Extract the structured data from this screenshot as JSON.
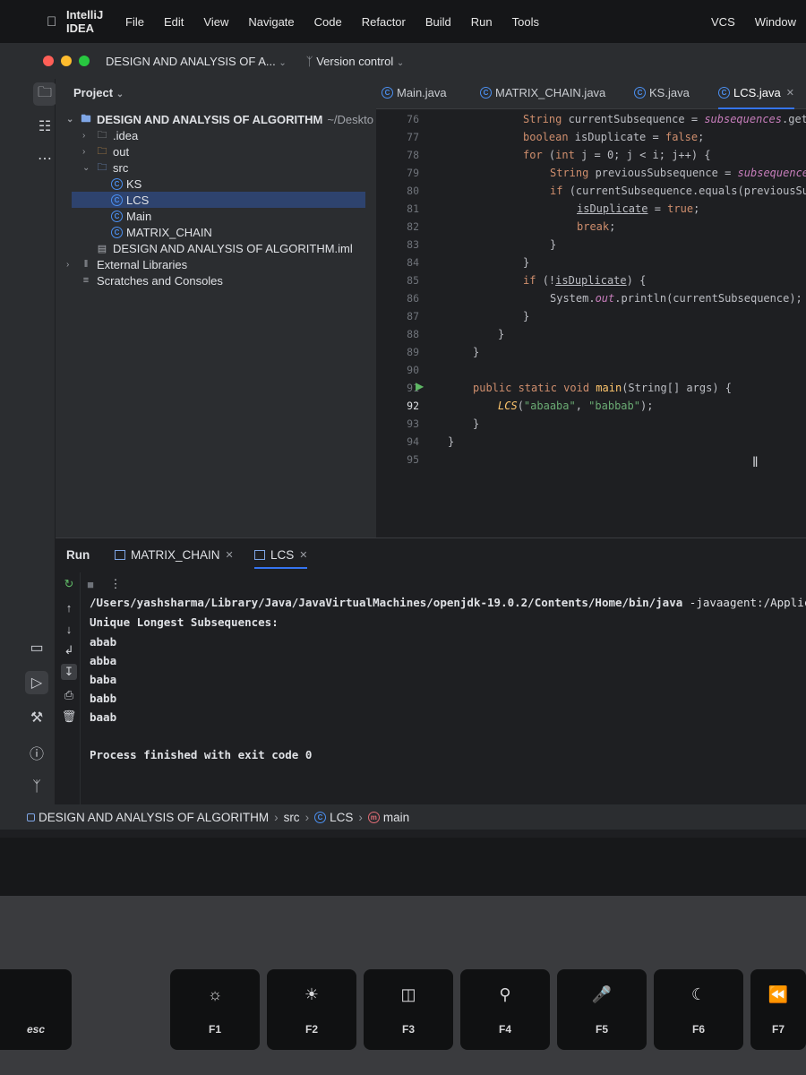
{
  "menubar": {
    "app": "IntelliJ IDEA",
    "items": [
      "File",
      "Edit",
      "View",
      "Navigate",
      "Code",
      "Refactor",
      "Build",
      "Run",
      "Tools",
      "VCS",
      "Window"
    ]
  },
  "titlebar": {
    "project": "DESIGN AND ANALYSIS OF A...",
    "version_control": "Version control"
  },
  "project_panel": {
    "title": "Project",
    "root": "DESIGN AND ANALYSIS OF ALGORITHM",
    "root_path": "~/Deskto",
    "idea": ".idea",
    "out": "out",
    "src": "src",
    "classes": [
      "KS",
      "LCS",
      "Main",
      "MATRIX_CHAIN"
    ],
    "iml": "DESIGN AND ANALYSIS OF ALGORITHM.iml",
    "external": "External Libraries",
    "scratches": "Scratches and Consoles"
  },
  "editor": {
    "tabs": [
      "Main.java",
      "MATRIX_CHAIN.java",
      "KS.java",
      "LCS.java"
    ],
    "line_numbers": [
      "76",
      "77",
      "78",
      "79",
      "80",
      "81",
      "82",
      "83",
      "84",
      "85",
      "86",
      "87",
      "88",
      "89",
      "90",
      "91",
      "92",
      "93",
      "94",
      "95"
    ],
    "code": {
      "l76a": "String ",
      "l76b": "currentSubsequence",
      "l76c": " = ",
      "l76d": "subsequences",
      "l76e": ".get(",
      "l77a": "boolean ",
      "l77b": "isDuplicate",
      "l77c": " = ",
      "l77d": "false",
      "l77e": ";",
      "l78a": "for ",
      "l78b": "(",
      "l78c": "int ",
      "l78d": "j = 0; j < i; j++) {",
      "l79a": "String ",
      "l79b": "previousSubsequence",
      "l79c": " = ",
      "l79d": "subsequence",
      "l80a": "if ",
      "l80b": "(currentSubsequence.equals(previousSu",
      "l81a": "isDuplicate",
      "l81b": " = ",
      "l81c": "true",
      "l81d": ";",
      "l82a": "break",
      "l82b": ";",
      "l83": "}",
      "l84": "}",
      "l85a": "if ",
      "l85b": "(!",
      "l85c": "isDuplicate",
      "l85d": ") {",
      "l86a": "System.",
      "l86b": "out",
      "l86c": ".println(currentSubsequence);",
      "l87": "}",
      "l88": "}",
      "l89": "}",
      "l91a": "public static void ",
      "l91b": "main",
      "l91c": "(String[] args) {",
      "l92a": "LCS",
      "l92b": "(",
      "l92c": "\"abaaba\"",
      "l92d": ", ",
      "l92e": "\"babbab\"",
      "l92f": ");",
      "l93": "}",
      "l94": "}"
    }
  },
  "run_window": {
    "title": "Run",
    "tabs": [
      "MATRIX_CHAIN",
      "LCS"
    ],
    "command_path": "/Users/yashsharma/Library/Java/JavaVirtualMachines/openjdk-19.0.2/Contents/Home/bin/java",
    "command_args": " -javaagent:/Applic",
    "output": [
      "Unique Longest Subsequences:",
      "abab",
      "abba",
      "baba",
      "babb",
      "baab"
    ],
    "exit": "Process finished with exit code 0"
  },
  "statusbar": {
    "crumbs": [
      "DESIGN AND ANALYSIS OF ALGORITHM",
      "src",
      "LCS",
      "main"
    ]
  },
  "keyboard": {
    "esc": "esc",
    "keys": [
      "F1",
      "F2",
      "F3",
      "F4",
      "F5",
      "F6",
      "F7"
    ]
  },
  "colors": {
    "accent": "#3574f0",
    "bg": "#1e1f22",
    "panel": "#2b2d30"
  }
}
